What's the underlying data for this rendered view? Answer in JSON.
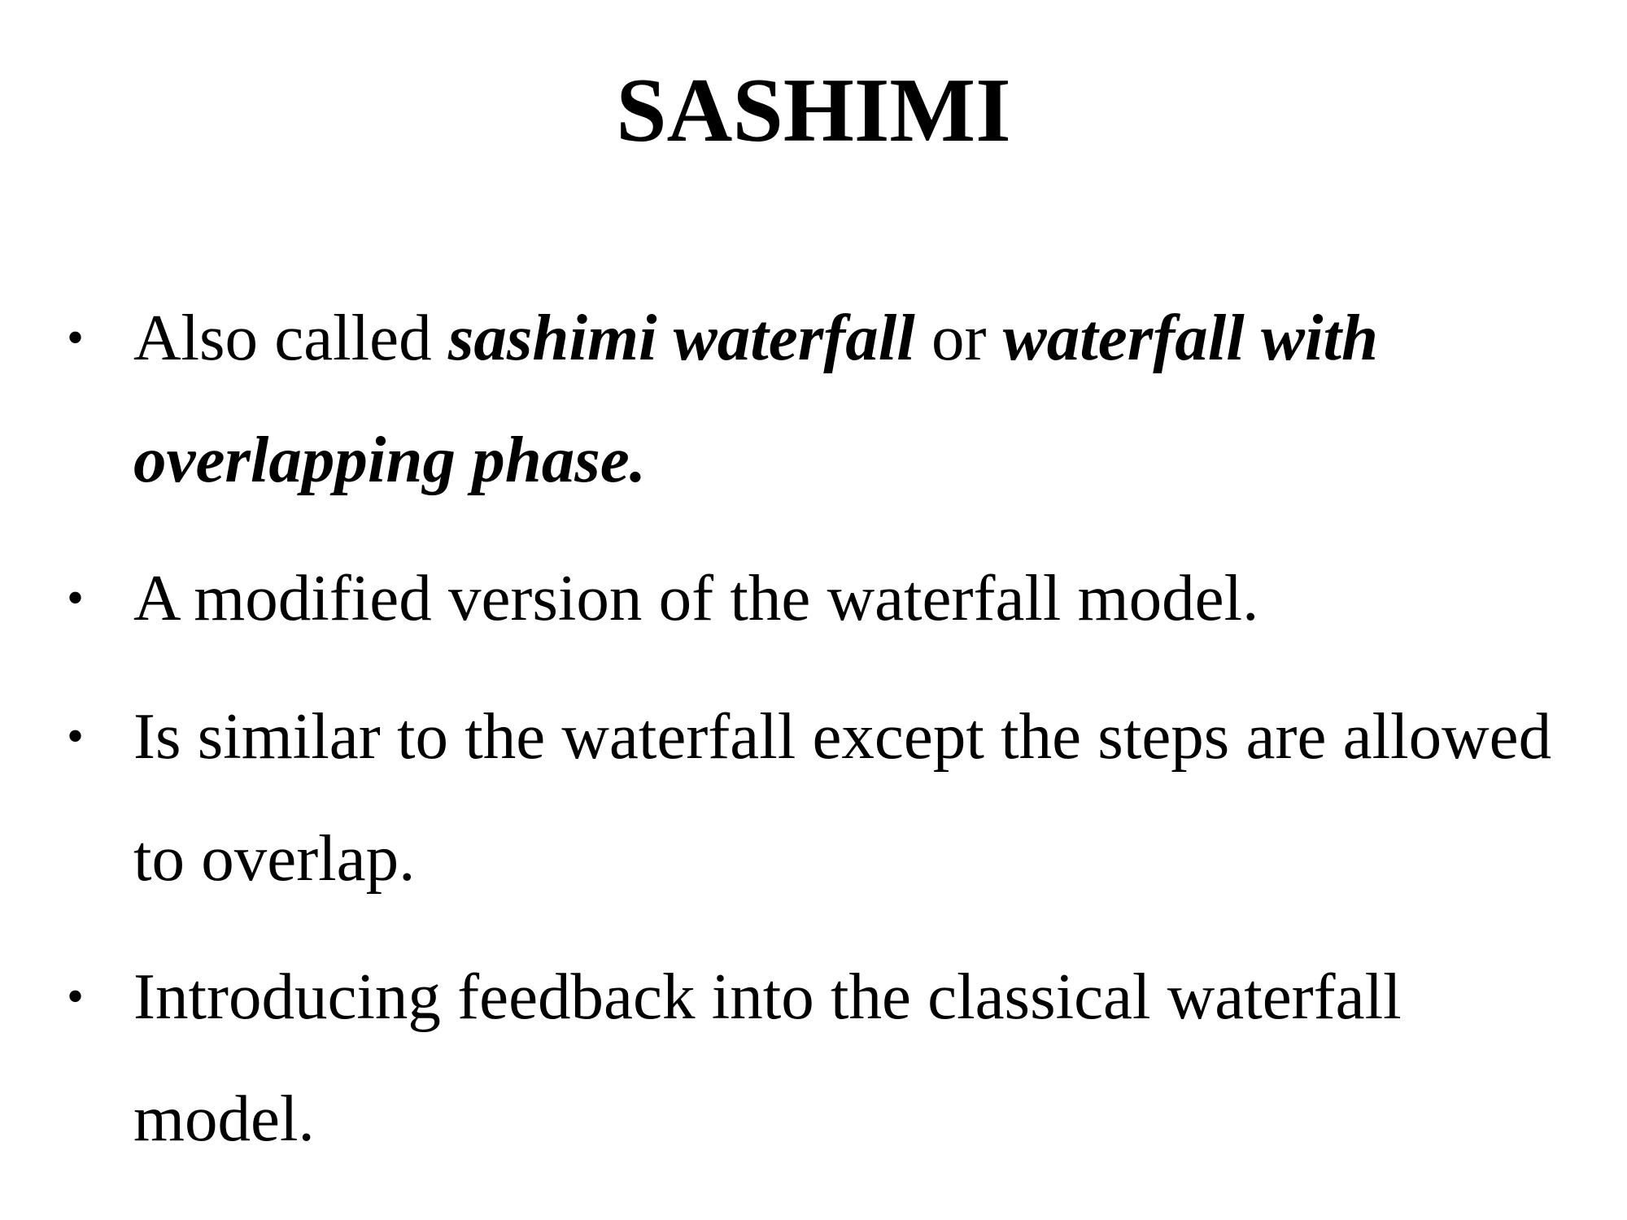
{
  "slide": {
    "title": "SASHIMI",
    "bullet_symbol": "•",
    "bullets": [
      {
        "part1": "Also called ",
        "part2": "sashimi waterfall",
        "part3": " or ",
        "part4": "waterfall with overlapping phase."
      },
      {
        "text": "A modified version of the waterfall model."
      },
      {
        "text": "Is similar to the waterfall except the steps are allowed to overlap."
      },
      {
        "text": "Introducing feedback into the classical waterfall model."
      }
    ]
  }
}
